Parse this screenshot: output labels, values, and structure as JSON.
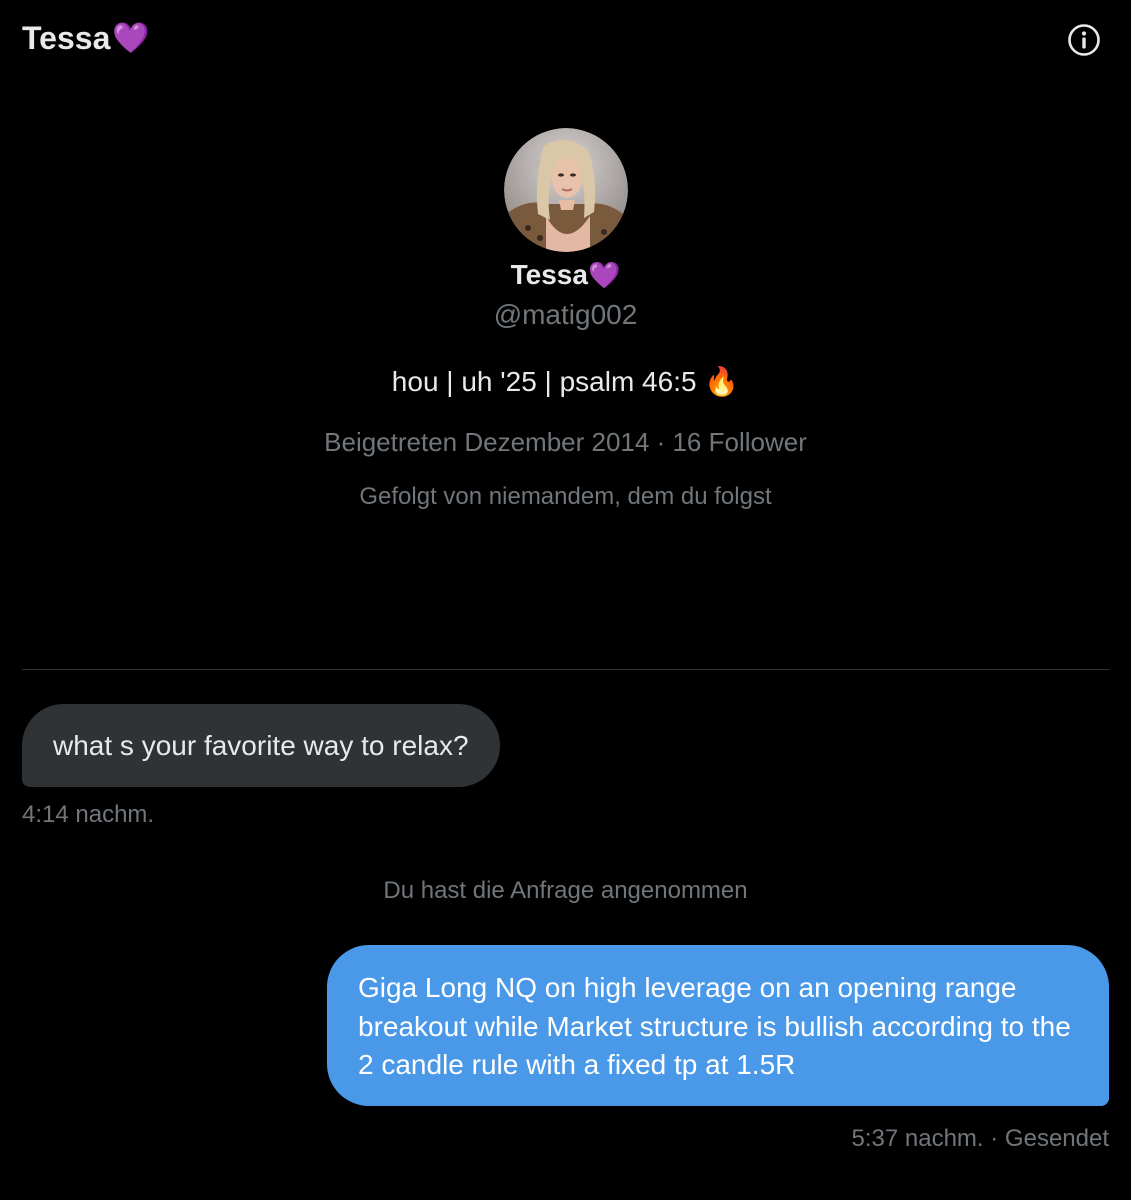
{
  "header": {
    "title": "Tessa",
    "title_emoji": "💜",
    "info_icon": "info-icon"
  },
  "profile": {
    "avatar_icon": "profile-photo",
    "name": "Tessa",
    "name_emoji": "💜",
    "handle": "@matig002",
    "bio": "hou | uh '25 | psalm 46:5 🔥",
    "joined": "Beigetreten Dezember 2014",
    "separator": " · ",
    "followers": "16 Follower",
    "followed_by": "Gefolgt von niemandem, dem du folgst"
  },
  "messages": [
    {
      "direction": "received",
      "text": "what s your favorite way to relax?",
      "time": "4:14 nachm."
    },
    {
      "direction": "sent",
      "text": "Giga Long NQ on high leverage on an opening range breakout while Market structure is bullish according to the 2 candle rule with a fixed tp at 1.5R",
      "time": "5:37 nachm.",
      "separator": " · ",
      "status": "Gesendet"
    }
  ],
  "system_note": "Du hast die Anfrage angenommen",
  "colors": {
    "background": "#000000",
    "text_primary": "#e7e9ea",
    "text_secondary": "#71767b",
    "received_bubble": "#2f3336",
    "sent_bubble": "#4a99e9",
    "heart": "#a98cd9",
    "divider": "#2f3336"
  }
}
